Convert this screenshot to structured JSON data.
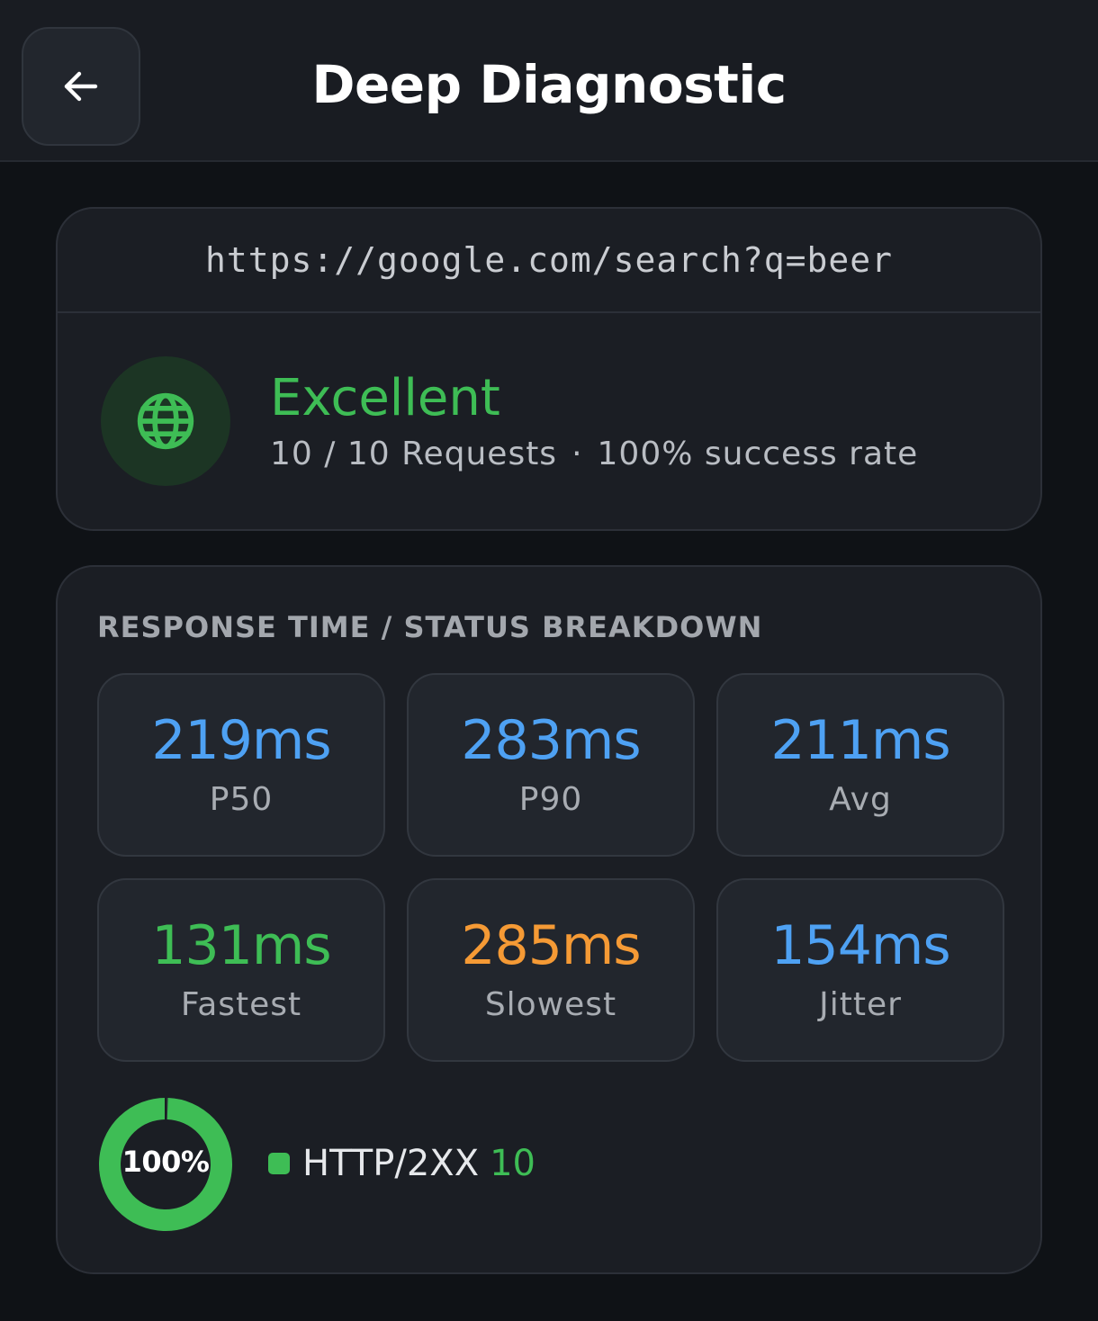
{
  "header": {
    "title": "Deep Diagnostic",
    "back_icon": "arrow-left-icon"
  },
  "target": {
    "url": "https://google.com/search?q=beer",
    "icon": "globe-icon",
    "status_label": "Excellent",
    "requests_text": "10 / 10 Requests",
    "separator": "·",
    "success_text": "100% success rate"
  },
  "metrics": {
    "section_label": "RESPONSE TIME / STATUS BREAKDOWN",
    "items": [
      {
        "value": "219ms",
        "label": "P50"
      },
      {
        "value": "283ms",
        "label": "P90"
      },
      {
        "value": "211ms",
        "label": "Avg"
      },
      {
        "value": "131ms",
        "label": "Fastest"
      },
      {
        "value": "285ms",
        "label": "Slowest"
      },
      {
        "value": "154ms",
        "label": "Jitter"
      }
    ]
  },
  "status_breakdown": {
    "percent_label": "100%",
    "percent_value": 100,
    "legend": [
      {
        "name": "HTTP/2XX",
        "count": "10",
        "color": "#3ebd55"
      }
    ]
  },
  "colors": {
    "accent_blue": "#4ea1f3",
    "success_green": "#3ebd55",
    "warning_orange": "#f59a35",
    "background": "#0f1216",
    "card": "#1b1e24"
  }
}
